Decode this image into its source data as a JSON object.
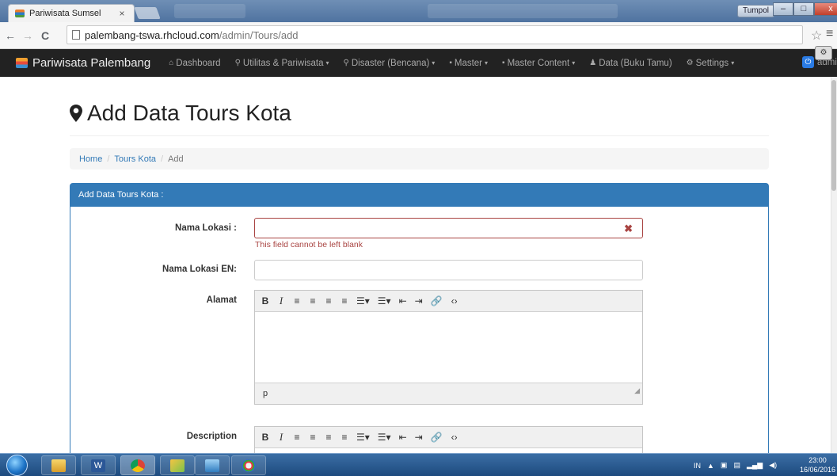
{
  "browser": {
    "tab_title": "Pariwisata Sumsel",
    "tab_close": "×",
    "user_chip": "Tumpol",
    "url_host": "palembang-tswa.rhcloud.com",
    "url_path": "/admin/Tours/add",
    "back": "←",
    "forward": "→",
    "reload": "C",
    "bookmark_star": "☆",
    "menu": "≡",
    "win_min": "–",
    "win_max": "□",
    "win_close": "x"
  },
  "navbar": {
    "brand": "Pariwisata Palembang",
    "items": [
      {
        "icon": "home-icon",
        "glyph": "⌂",
        "label": "Dashboard",
        "caret": ""
      },
      {
        "icon": "map-marker-icon",
        "glyph": "⚲",
        "label": "Utilitas & Pariwisata",
        "caret": "▾"
      },
      {
        "icon": "map-marker-icon",
        "glyph": "⚲",
        "label": "Disaster (Bencana)",
        "caret": "▾"
      },
      {
        "icon": "folder-icon",
        "glyph": "▪",
        "label": "Master",
        "caret": "▾"
      },
      {
        "icon": "folder-icon",
        "glyph": "▪",
        "label": "Master Content",
        "caret": "▾"
      },
      {
        "icon": "user-icon",
        "glyph": "♟",
        "label": "Data (Buku Tamu)",
        "caret": ""
      },
      {
        "icon": "gear-icon",
        "glyph": "⚙",
        "label": "Settings",
        "caret": "▾"
      }
    ],
    "admin_label": "admin"
  },
  "page": {
    "title": "Add Data Tours Kota",
    "breadcrumb": {
      "home": "Home",
      "section": "Tours Kota",
      "current": "Add",
      "sep": "/"
    },
    "panel_title": "Add Data Tours Kota :"
  },
  "form": {
    "nama_lokasi_label": "Nama Lokasi :",
    "nama_lokasi_value": "",
    "nama_lokasi_error": "This field cannot be left blank",
    "nama_lokasi_en_label": "Nama Lokasi EN:",
    "nama_lokasi_en_value": "",
    "alamat_label": "Alamat",
    "alamat_status": "p",
    "description_label": "Description"
  },
  "editor_toolbar": [
    "B",
    "I",
    "≡",
    "≡",
    "≡",
    "≡",
    "☰▾",
    "☰▾",
    "⇤",
    "⇥",
    "🔗",
    "‹›"
  ],
  "taskbar": {
    "tray_lang": "IN",
    "time": "23:00",
    "date": "16/06/2016"
  },
  "colors": {
    "primary": "#337ab7",
    "error": "#a94442",
    "navbar": "#222222"
  }
}
